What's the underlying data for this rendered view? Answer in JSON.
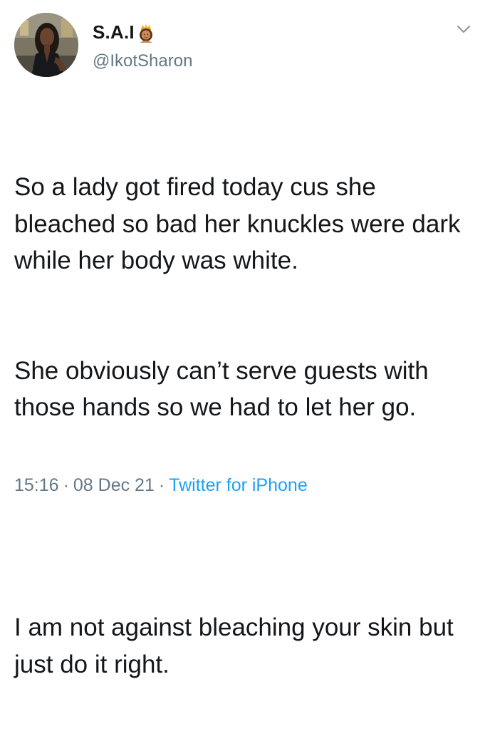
{
  "tweet": {
    "display_name": "S.A.I",
    "handle": "@IkotSharon",
    "paragraphs": [
      "So a lady got fired today cus she bleached so bad her knuckles were dark while her body was white.",
      "She obviously can’t serve guests with those hands so we had to let her go.",
      "I am not against bleaching your skin but just do it right."
    ],
    "time": "15:16",
    "date": "08 Dec 21",
    "source": "Twitter for iPhone",
    "separator": "·",
    "name_emoji": "woman-with-crown-emoji"
  },
  "colors": {
    "text": "#14171a",
    "secondary": "#657786",
    "link": "#1da1f2",
    "background": "#ffffff"
  }
}
